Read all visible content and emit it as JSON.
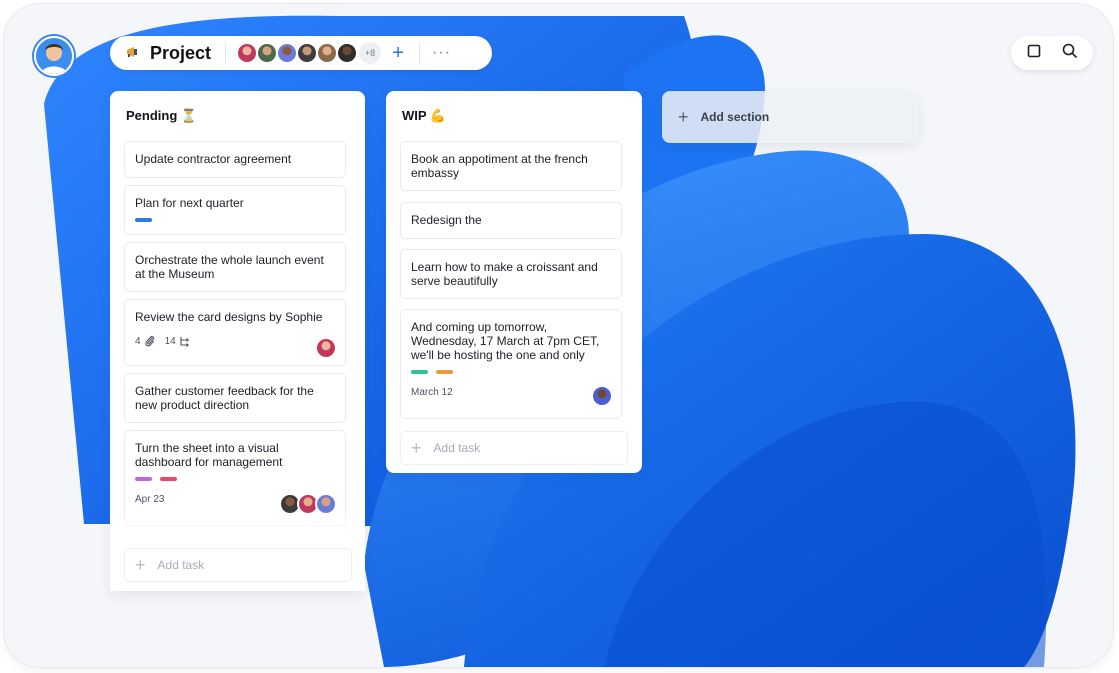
{
  "header": {
    "project_title": "Project",
    "extra_members_count": "+8"
  },
  "colors": {
    "accent_blue": "#2b6de8",
    "tag_blue": "#2b7ce9",
    "tag_green": "#2ec39a",
    "tag_orange": "#e99a3c",
    "tag_purple": "#c266e0",
    "tag_red": "#ef4466"
  },
  "columns": [
    {
      "title": "Pending ⏳",
      "cards": [
        {
          "text": "Update contractor agreement"
        },
        {
          "text": "Plan for next quarter",
          "tags": [
            "blue"
          ]
        },
        {
          "text": "Orchestrate the whole launch event at the Museum"
        },
        {
          "text": "Review the card designs by Sophie",
          "attachments": "4",
          "subtasks": "14"
        },
        {
          "text": "Gather customer feedback for the new product direction"
        },
        {
          "text": "Turn the sheet into a visual dashboard for management",
          "tags": [
            "purple",
            "red"
          ],
          "date": "Apr 23"
        }
      ],
      "add_task_label": "Add task"
    },
    {
      "title": "WIP 💪",
      "cards": [
        {
          "text": "Book an appotiment at the french embassy"
        },
        {
          "text": "Redesign the"
        },
        {
          "text": "Learn how to make a croissant and serve beautifully"
        },
        {
          "text": "And coming up tomorrow, Wednesday, 17 March at 7pm CET, we'll be hosting the one and only",
          "tags": [
            "green",
            "orange"
          ],
          "date": "March 12"
        }
      ],
      "add_task_label": "Add task"
    }
  ],
  "add_section_label": "Add section",
  "icons": {
    "project": "megaphone-icon",
    "more": "more-horizontal-icon",
    "add_member": "plus-icon",
    "window": "square-icon",
    "search": "search-icon",
    "attachment": "paperclip-icon",
    "subtask": "subtask-icon"
  }
}
